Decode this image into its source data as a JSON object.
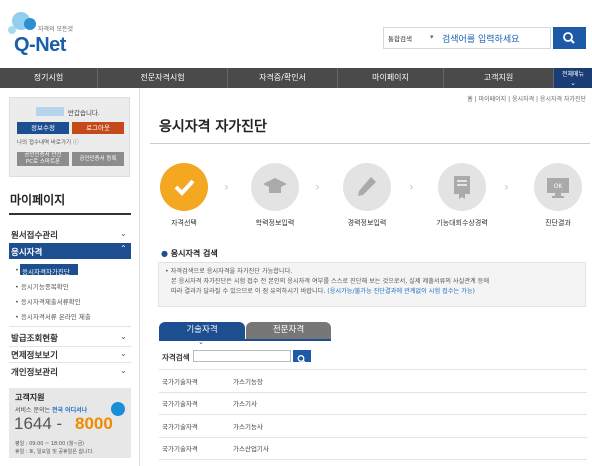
{
  "brand": {
    "subtitle": "자격의 모든것",
    "name": "Q-Net"
  },
  "search": {
    "scope": "통합검색",
    "placeholder": "검색어를 입력하세요"
  },
  "nav": {
    "items": [
      "정기시험",
      "전문자격시험",
      "자격증/확인서",
      "마이페이지",
      "고객지원"
    ],
    "all_menu": "전체메뉴"
  },
  "login": {
    "greeting": "반갑습니다.",
    "info_button": "정보수정",
    "logout_button": "로그아웃",
    "history_link": "나의 접수내역 바로가기",
    "cert_button": "공인인증서 안전\nPC로 스마트폰",
    "cert_register_button": "공인인증서 등록"
  },
  "sidebar": {
    "title": "마이페이지",
    "menus": [
      "원서접수관리",
      "응시자격",
      "발급조회현황",
      "면제정보보기",
      "개인정보관리"
    ],
    "submenus": [
      "응시자격자가진단",
      "응시기능종목확인",
      "응시자격제출서류확인",
      "응시자격서류 온라인 제출"
    ]
  },
  "support": {
    "title": "고객지원",
    "line1": "서비스 문의는 ",
    "line1_highlight": "전국 어디서나",
    "phone_a": "1644 -",
    "phone_b": "8000",
    "hours": "평일 : 09:00 ~ 18:00 (월~금)",
    "holiday": "휴일 : 토, 일요일 및 공휴일은 쉽니다."
  },
  "breadcrumb": "홈 | 마이페이지 | 응시자격 | 응시자격 자가진단",
  "page_title": "응시자격 자가진단",
  "steps": [
    "자격선택",
    "학력정보입력",
    "경력정보입력",
    "기능대회수상경력",
    "진단결과"
  ],
  "check": {
    "title": "응시자격 검색",
    "notice_1": "• 자격검색으로 응시자격을 자가진단 가능합니다.",
    "notice_2": "본 응시자격 자가진단은 시험 접수 전 본인의 응시자격 여부를 스스로 진단해 보는 것으로서, 실제 제출서류의 사실관계 등에",
    "notice_3": "따라 결과가 달라질 수 있으므로 이 점 유의하시기 바랍니다.",
    "notice_3_link": "(응시가능/불가능 진단결과에 관계없이 시험 접수는 가능)"
  },
  "tabs": [
    "기술자격",
    "전문자격"
  ],
  "filter": {
    "label": "자격검색"
  },
  "rows": [
    {
      "category": "국가기술자격",
      "name": "가스기능장"
    },
    {
      "category": "국가기술자격",
      "name": "가스기사"
    },
    {
      "category": "국가기술자격",
      "name": "가스기능사"
    },
    {
      "category": "국가기술자격",
      "name": "가스산업기사"
    }
  ],
  "colors": {
    "brand_blue": "#1d4e8f",
    "accent_orange": "#f4a720",
    "nav_gray": "#4a4a4a",
    "logout_red": "#c44a1a"
  }
}
